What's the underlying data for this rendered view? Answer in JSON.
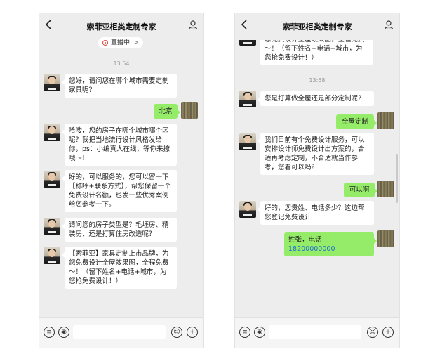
{
  "title": "索菲亚柜类定制专家",
  "live_label": "直播中",
  "live_chevron": ">",
  "left": {
    "time": "13:54",
    "messages": [
      {
        "from": "agent",
        "text": "您好，请问您在哪个城市需要定制家具呢？"
      },
      {
        "from": "user",
        "text": "北京"
      },
      {
        "from": "agent",
        "text": "哈喽，您的房子在哪个城市哪个区呢？我把当地流行设计风格发给你，ps：小编真人在线，等你来撩哦～!"
      },
      {
        "from": "agent",
        "text": "好的，可以服务的，您可以留一下【称呼+联系方式】，帮您保留一个免费设计名额，也发一些优秀案例给您参考一下。"
      },
      {
        "from": "agent",
        "text": "请问您的房子类型是？毛坯房、精装房、还是打算住房改造呢？"
      },
      {
        "from": "agent",
        "text": "【索菲亚】家具定制上市品牌，为您免费设计全屋效果图，全程免费～！（留下姓名+电话+城市，为您抢免费设计！）"
      }
    ]
  },
  "right": {
    "time": "13:58",
    "top_partial": "【索菲亚】家具定制上市品牌，为您免费设计全屋效果图，全程免费～！（留下姓名+电话+城市，为您抢免费设计！）",
    "messages": [
      {
        "from": "agent",
        "text": "您是打算做全屋还是部分定制呢？"
      },
      {
        "from": "user",
        "text": "全屋定制"
      },
      {
        "from": "agent",
        "text": "我们目前有个免费设计服务，可以安排设计师免费设计出方案的，合适再考虑定制，不合适就当作参考，您看可以吗？"
      },
      {
        "from": "user",
        "text": "可以啊"
      },
      {
        "from": "agent",
        "text": "好的，您贵姓、电话多少？这边帮您登记免费设计"
      }
    ],
    "last_user_prefix": "姓张，电话 ",
    "last_user_phone": "18200000000"
  },
  "icons": [
    "back-chevron-icon",
    "person-icon",
    "voice-icon",
    "menu-icon",
    "emoji-icon",
    "plus-icon"
  ]
}
